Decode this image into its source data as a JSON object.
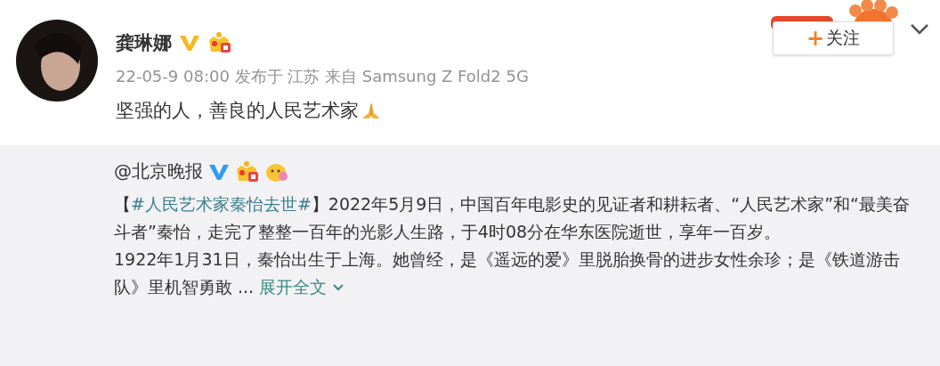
{
  "author": {
    "name": "龚琳娜",
    "verified": true
  },
  "meta": "22-05-9 08:00 发布于 江苏 来自 Samsung Z Fold2 5G",
  "follow_button": {
    "icon": "+",
    "label": "关注"
  },
  "text": "坚强的人，善良的人民艺术家",
  "repost": {
    "author": "@北京晚报",
    "verified": true,
    "lead": {
      "open": "【",
      "topic": "#人民艺术家秦怡去世#",
      "close": "】2022年5月9日，中国百年电影史的见证者和耕耘者、“人民艺术家”和“最美奋斗者”秦怡，走完了整整一百年的光影人生路，于4时08分在华东医院逝世，享年一百岁。"
    },
    "paragraphs": [
      "1922年1月31日，秦怡出生于上海。她曾经，是《遥远的爱》里脱胎换骨的进步女性余珍；是《铁道游击队》里机智勇敢 ..."
    ],
    "expand": "展开全文"
  }
}
